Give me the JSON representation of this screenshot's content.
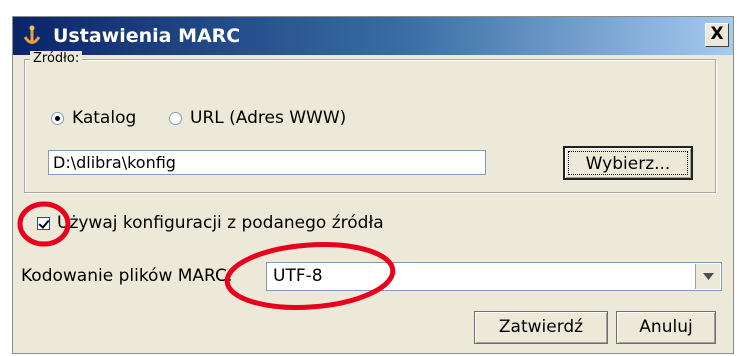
{
  "window": {
    "title": "Ustawienia MARC",
    "close_label": "X"
  },
  "source_group": {
    "legend": "Źródło:",
    "radio_options": [
      {
        "label": "Katalog",
        "selected": true
      },
      {
        "label": "URL (Adres WWW)",
        "selected": false
      }
    ],
    "path_value": "D:\\dlibra\\konfig",
    "browse_label": "Wybierz..."
  },
  "use_config": {
    "label": "Używaj konfiguracji z podanego źródła",
    "checked": true
  },
  "encoding": {
    "label": "Kodowanie plików MARC:",
    "selected": "UTF-8"
  },
  "buttons": {
    "ok_label": "Zatwierdź",
    "cancel_label": "Anuluj"
  },
  "icons": {
    "app": "dlibra-app-icon",
    "dropdown": "chevron-down-icon"
  },
  "colors": {
    "titlebar_start": "#0a246a",
    "titlebar_end": "#a6caf0",
    "dialog_bg": "#ece9d8",
    "annotation_red": "#e8001c"
  }
}
